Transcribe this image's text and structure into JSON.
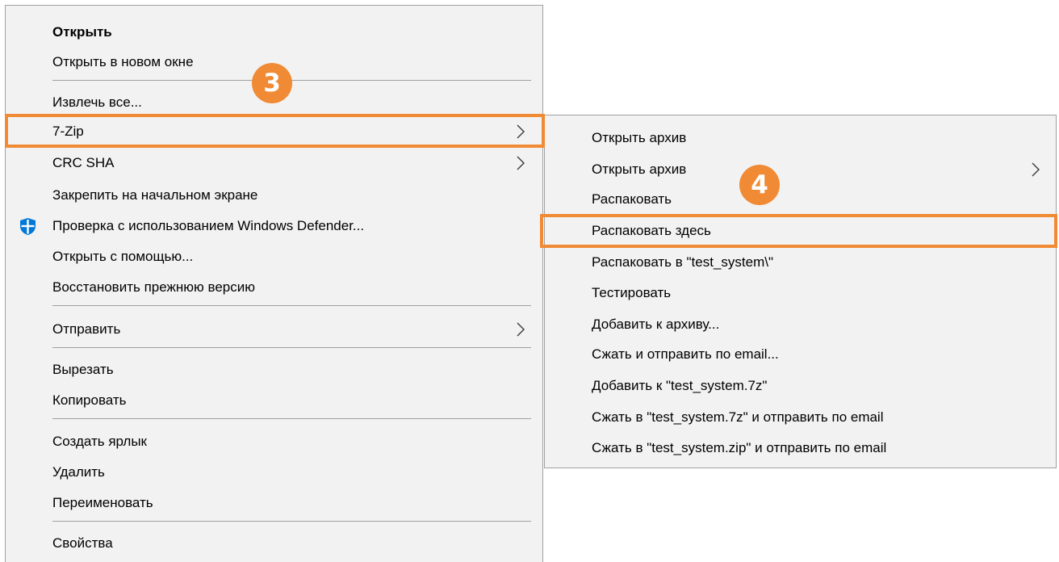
{
  "main_menu": {
    "items": [
      {
        "label": "Открыть"
      },
      {
        "label": "Открыть в новом окне"
      },
      {
        "label": "Извлечь все..."
      },
      {
        "label": "7-Zip"
      },
      {
        "label": "CRC SHA"
      },
      {
        "label": "Закрепить на начальном экране"
      },
      {
        "label": "Проверка с использованием Windows Defender...",
        "icon": "windows-defender-icon"
      },
      {
        "label": "Открыть с помощью..."
      },
      {
        "label": "Восстановить прежнюю версию"
      },
      {
        "label": "Отправить"
      },
      {
        "label": "Вырезать"
      },
      {
        "label": "Копировать"
      },
      {
        "label": "Создать ярлык"
      },
      {
        "label": "Удалить"
      },
      {
        "label": "Переименовать"
      },
      {
        "label": "Свойства"
      }
    ]
  },
  "submenu_7zip": {
    "items": [
      {
        "label": "Открыть архив"
      },
      {
        "label": "Открыть архив"
      },
      {
        "label": "Распаковать"
      },
      {
        "label": "Распаковать здесь"
      },
      {
        "label": "Распаковать в \"test_system\\\""
      },
      {
        "label": "Тестировать"
      },
      {
        "label": "Добавить к архиву..."
      },
      {
        "label": "Сжать и отправить по email..."
      },
      {
        "label": "Добавить к \"test_system.7z\""
      },
      {
        "label": "Сжать в \"test_system.7z\" и отправить по email"
      },
      {
        "label": "Сжать в \"test_system.zip\" и отправить по email"
      }
    ]
  },
  "annotations": {
    "step3": "3",
    "step4": "4"
  },
  "colors": {
    "menu_bg": "#f2f2f2",
    "menu_border": "#a0a0a0",
    "accent_orange": "#f08a34",
    "defender_blue": "#0078d7"
  }
}
